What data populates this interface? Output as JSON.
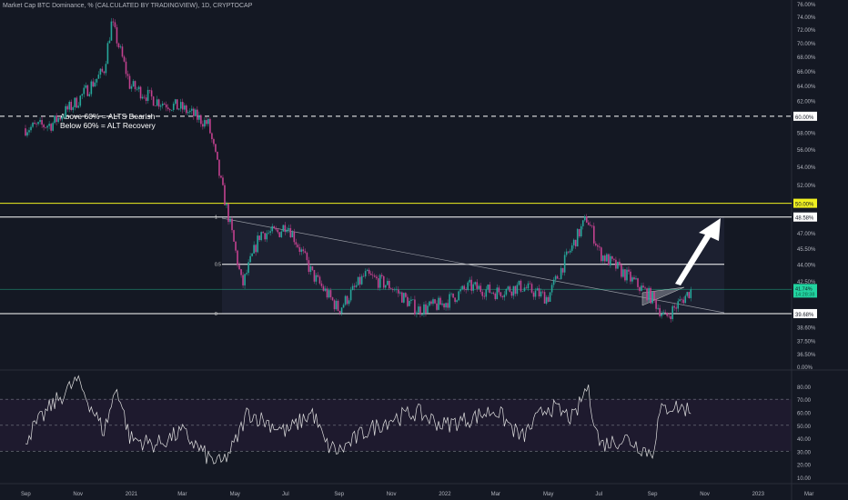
{
  "header": {
    "title": "Market Cap BTC Dominance, % (CALCULATED BY TRADINGVIEW), 1D, CRYPTOCAP"
  },
  "chart_data": {
    "type": "candlestick+line",
    "title": "Market Cap BTC Dominance, % (CALCULATED BY TRADINGVIEW), 1D, CRYPTOCAP",
    "price_axis": {
      "ticks": [
        "76.00%",
        "74.00%",
        "72.00%",
        "70.00%",
        "68.00%",
        "66.00%",
        "64.00%",
        "62.00%",
        "58.00%",
        "56.00%",
        "54.00%",
        "52.00%",
        "47.00%",
        "45.50%",
        "44.00%",
        "42.50%",
        "38.60%",
        "37.50%",
        "36.50%",
        "0.00%"
      ],
      "tick_values": [
        76,
        74,
        72,
        70,
        68,
        66,
        64,
        62,
        58,
        56,
        54,
        52,
        47,
        45.5,
        44,
        42.5,
        38.6,
        37.5,
        36.5
      ],
      "scale": "log"
    },
    "levels": [
      {
        "value": 60,
        "label": "60.00%",
        "color": "#ffffff",
        "style": "dashed"
      },
      {
        "value": 50,
        "label": "50.00%",
        "color": "#f0f020",
        "style": "solid"
      },
      {
        "value": 48.58,
        "label": "48.58%",
        "color": "#ffffff",
        "style": "solid"
      },
      {
        "value": 39.68,
        "label": "39.68%",
        "color": "#ffffff",
        "style": "solid"
      }
    ],
    "last_price": {
      "label": "41.74%",
      "countdown": "14:28:38",
      "value": 41.74,
      "color": "#22d3a0"
    },
    "fib": [
      {
        "label": "1",
        "value": 48.58
      },
      {
        "label": "0.5",
        "value": 44.0
      },
      {
        "label": "0",
        "value": 39.68
      }
    ],
    "annotations": [
      "Above 60% = ALTS Bearish",
      "Below 60% = ALT Recovery"
    ],
    "time_axis": [
      "Sep",
      "Nov",
      "2021",
      "Mar",
      "May",
      "Jul",
      "Sep",
      "Nov",
      "2022",
      "Mar",
      "May",
      "Jul",
      "Sep",
      "Nov",
      "2023",
      "Mar"
    ],
    "price_series": {
      "month_index": [
        0,
        1,
        2,
        3,
        3.3,
        4,
        5,
        6,
        7,
        7.5,
        8.3,
        9,
        9.7,
        10,
        11,
        12,
        13,
        14,
        15,
        16,
        17,
        18,
        19,
        20,
        21.5,
        22,
        23,
        24,
        24.5,
        25.5
      ],
      "values": [
        58.5,
        59,
        62,
        66,
        73,
        64,
        62,
        61,
        59,
        52,
        42,
        47,
        47,
        48,
        43,
        40,
        43,
        42,
        40,
        40.5,
        42,
        41.5,
        42,
        41,
        48.5,
        45,
        43,
        41,
        39.3,
        41.7
      ]
    },
    "rsi": {
      "axis": [
        "80.00",
        "70.00",
        "60.00",
        "50.00",
        "40.00",
        "30.00",
        "20.00",
        "10.00"
      ],
      "bands": [
        70,
        50,
        30
      ],
      "month_index": [
        0,
        1,
        2,
        3,
        3.5,
        4,
        5,
        6,
        7,
        7.5,
        8,
        8.5,
        9,
        10,
        11,
        11.5,
        12,
        13,
        14,
        15,
        16,
        17,
        18,
        19,
        20,
        21,
        21.5,
        22,
        23,
        24,
        24.3,
        24.7,
        25.5
      ],
      "values": [
        40,
        65,
        85,
        45,
        80,
        40,
        35,
        45,
        25,
        20,
        35,
        60,
        55,
        45,
        60,
        35,
        30,
        45,
        55,
        60,
        50,
        55,
        62,
        40,
        65,
        55,
        80,
        35,
        40,
        28,
        60,
        65,
        62
      ]
    }
  }
}
